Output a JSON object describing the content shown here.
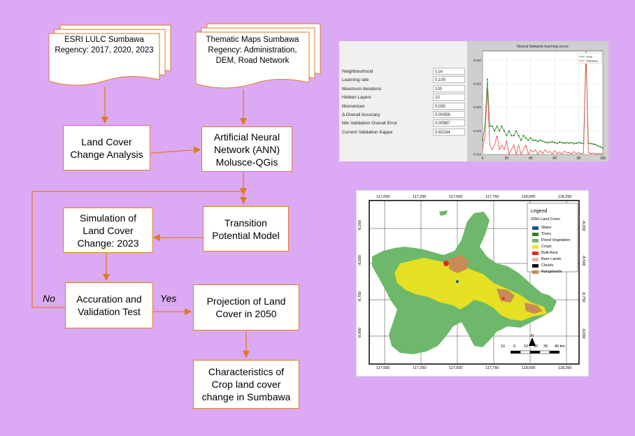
{
  "flowchart": {
    "doc_lulc": "ESRI LULC Sumbawa Regency: 2017, 2020, 2023",
    "doc_thematic": "Thematic Maps Sumbawa Regency: Administration, DEM, Road Network",
    "land_cover_change": "Land Cover Change Analysis",
    "ann": "Artificial Neural Network (ANN) Molusce-QGis",
    "transition": "Transition Potential Model",
    "simulation": "Simulation of Land Cover Change: 2023",
    "accuration": "Accuration and Validation Test",
    "projection": "Projection of Land Cover in 2050",
    "characteristics": "Characteristics of Crop land cover change in Sumbawa",
    "label_no": "No",
    "label_yes": "Yes",
    "arrow_color": "#e07a22"
  },
  "ann_panel": {
    "params": [
      {
        "key": "Neighbourhood",
        "value": "1 px"
      },
      {
        "key": "Learning rate",
        "value": "0,100"
      },
      {
        "key": "Maximum iterations",
        "value": "100"
      },
      {
        "key": "Hidden Layers",
        "value": "10"
      },
      {
        "key": "Momentum",
        "value": "0,050"
      },
      {
        "key": "Δ Overall Accuracy",
        "value": "0.00058"
      },
      {
        "key": "Min Validation Overall Error",
        "value": "0.00987"
      },
      {
        "key": "Current Validation Kappa",
        "value": "0.82244"
      }
    ]
  },
  "chart_data": {
    "type": "line",
    "title": "Neural Network learning curve",
    "xlim": [
      0,
      100
    ],
    "ylim": [
      0.01,
      0.032
    ],
    "x_ticks": [
      "0",
      "20",
      "40",
      "60",
      "80",
      "100"
    ],
    "y_ticks": [
      "0.010",
      "0.015",
      "0.020",
      "0.025",
      "0.030"
    ],
    "grid": true,
    "legend_position": "top-right",
    "series": [
      {
        "name": "Train",
        "color": "#2e8b2e",
        "x": [
          0,
          2,
          4,
          6,
          8,
          10,
          12,
          14,
          16,
          18,
          20,
          22,
          24,
          26,
          28,
          30,
          32,
          34,
          36,
          38,
          40,
          42,
          44,
          46,
          48,
          50,
          52,
          54,
          56,
          58,
          60,
          62,
          64,
          66,
          68,
          70,
          72,
          74,
          76,
          78,
          80,
          82,
          84,
          86,
          88,
          90,
          92,
          94,
          96,
          98,
          100
        ],
        "values": [
          0.013,
          0.016,
          0.026,
          0.016,
          0.016,
          0.015,
          0.016,
          0.015,
          0.016,
          0.015,
          0.014,
          0.015,
          0.014,
          0.014,
          0.015,
          0.014,
          0.013,
          0.014,
          0.0135,
          0.013,
          0.0135,
          0.013,
          0.013,
          0.0128,
          0.013,
          0.0128,
          0.0126,
          0.0125,
          0.0126,
          0.0127,
          0.0125,
          0.0124,
          0.0126,
          0.0125,
          0.0124,
          0.0125,
          0.0124,
          0.0125,
          0.0123,
          0.0124,
          0.0125,
          0.0124,
          0.0123,
          0.031,
          0.0124,
          0.0123,
          0.0122,
          0.0121,
          0.0118,
          0.0116,
          0.0114
        ]
      },
      {
        "name": "Validation",
        "color": "#e8403a",
        "x": [
          0,
          2,
          4,
          6,
          8,
          10,
          12,
          14,
          16,
          18,
          20,
          22,
          24,
          26,
          28,
          30,
          32,
          34,
          36,
          38,
          40,
          42,
          44,
          46,
          48,
          50,
          52,
          54,
          56,
          58,
          60,
          62,
          64,
          66,
          68,
          70,
          72,
          74,
          76,
          78,
          80,
          82,
          84,
          86,
          88,
          90,
          92,
          94,
          96,
          98,
          100
        ],
        "values": [
          0.011,
          0.014,
          0.024,
          0.012,
          0.011,
          0.012,
          0.014,
          0.011,
          0.012,
          0.011,
          0.013,
          0.01,
          0.011,
          0.012,
          0.01,
          0.012,
          0.01,
          0.011,
          0.012,
          0.01,
          0.011,
          0.0105,
          0.011,
          0.01,
          0.0108,
          0.0102,
          0.011,
          0.0104,
          0.0106,
          0.0101,
          0.0108,
          0.0102,
          0.0105,
          0.0101,
          0.0107,
          0.0103,
          0.0104,
          0.0101,
          0.0106,
          0.0102,
          0.0104,
          0.0101,
          0.0103,
          0.032,
          0.0104,
          0.0102,
          0.0103,
          0.0101,
          0.0102,
          0.0101,
          0.0102
        ]
      }
    ]
  },
  "map_panel": {
    "legend_title": "Legend",
    "legend_subtitle": "2050 Land Cover",
    "legend": [
      {
        "label": "Water",
        "color": "#1f4e9e"
      },
      {
        "label": "Trees",
        "color": "#3a7d2f"
      },
      {
        "label": "Flood Vegetation",
        "color": "#6db86a"
      },
      {
        "label": "Crops",
        "color": "#f2e41c"
      },
      {
        "label": "Built Area",
        "color": "#e8262a"
      },
      {
        "label": "Bare Lands",
        "color": "#e7b3a6"
      },
      {
        "label": "Clouds",
        "color": "#111111"
      },
      {
        "label": "Rangelands",
        "color": "#c98a55"
      }
    ],
    "top_ticks": [
      "117,000",
      "117,250",
      "117,500",
      "117,750",
      "118,000",
      "118,250"
    ],
    "bottom_ticks": [
      "117,000",
      "117,250",
      "117,500",
      "117,750",
      "118,000",
      "118,250"
    ],
    "left_ticks": [
      "-8,250",
      "-8,500",
      "-8,750",
      "-9,000"
    ],
    "right_ticks": [
      "-8,250",
      "-8,500",
      "-8,750",
      "-9,000"
    ],
    "scale_labels": [
      "10",
      "0",
      "10",
      "20",
      "30",
      "40 km"
    ],
    "north": "N"
  }
}
